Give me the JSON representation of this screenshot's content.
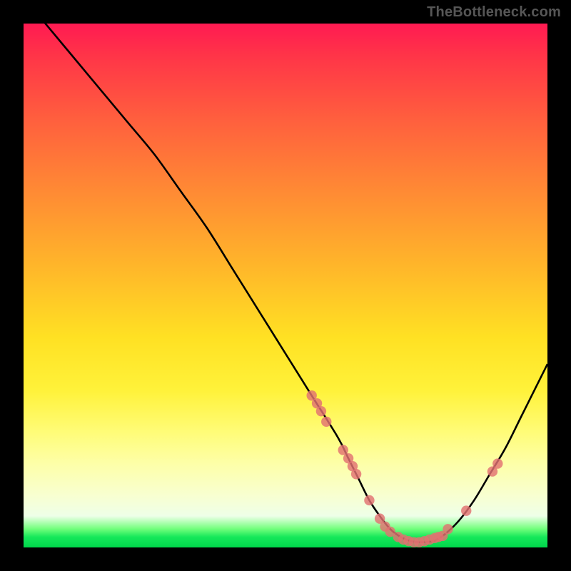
{
  "attribution": "TheBottleneck.com",
  "chart_data": {
    "type": "line",
    "title": "",
    "xlabel": "",
    "ylabel": "",
    "xlim": [
      0,
      100
    ],
    "ylim": [
      0,
      100
    ],
    "series": [
      {
        "name": "curve",
        "x": [
          0,
          5,
          10,
          15,
          20,
          25,
          30,
          35,
          40,
          45,
          50,
          55,
          60,
          62,
          64,
          66,
          68,
          70,
          72,
          74,
          76,
          78,
          80,
          83,
          86,
          89,
          92,
          95,
          98,
          100
        ],
        "values": [
          105,
          99,
          93,
          87,
          81,
          75,
          68,
          61,
          53,
          45,
          37,
          29,
          21,
          17,
          13,
          9,
          6,
          3.5,
          2,
          1.2,
          1,
          1.2,
          2.2,
          5,
          9,
          14,
          19,
          25,
          31,
          35
        ]
      }
    ],
    "markers": [
      {
        "x": 55.0,
        "y": 29.0
      },
      {
        "x": 56.0,
        "y": 27.5
      },
      {
        "x": 56.8,
        "y": 26.0
      },
      {
        "x": 57.8,
        "y": 24.0
      },
      {
        "x": 61.0,
        "y": 18.6
      },
      {
        "x": 62.0,
        "y": 17.0
      },
      {
        "x": 62.8,
        "y": 15.5
      },
      {
        "x": 63.5,
        "y": 14.0
      },
      {
        "x": 66.0,
        "y": 9.0
      },
      {
        "x": 68.0,
        "y": 5.5
      },
      {
        "x": 69.0,
        "y": 4.0
      },
      {
        "x": 70.0,
        "y": 3.0
      },
      {
        "x": 71.5,
        "y": 2.0
      },
      {
        "x": 72.5,
        "y": 1.5
      },
      {
        "x": 73.5,
        "y": 1.2
      },
      {
        "x": 74.5,
        "y": 1.0
      },
      {
        "x": 75.5,
        "y": 1.0
      },
      {
        "x": 76.5,
        "y": 1.2
      },
      {
        "x": 77.5,
        "y": 1.5
      },
      {
        "x": 78.5,
        "y": 1.8
      },
      {
        "x": 79.2,
        "y": 2.0
      },
      {
        "x": 80.0,
        "y": 2.2
      },
      {
        "x": 81.0,
        "y": 3.5
      },
      {
        "x": 84.5,
        "y": 7.0
      },
      {
        "x": 89.5,
        "y": 14.5
      },
      {
        "x": 90.5,
        "y": 16.0
      }
    ],
    "marker_color": "#e27272",
    "curve_color": "#000000"
  }
}
